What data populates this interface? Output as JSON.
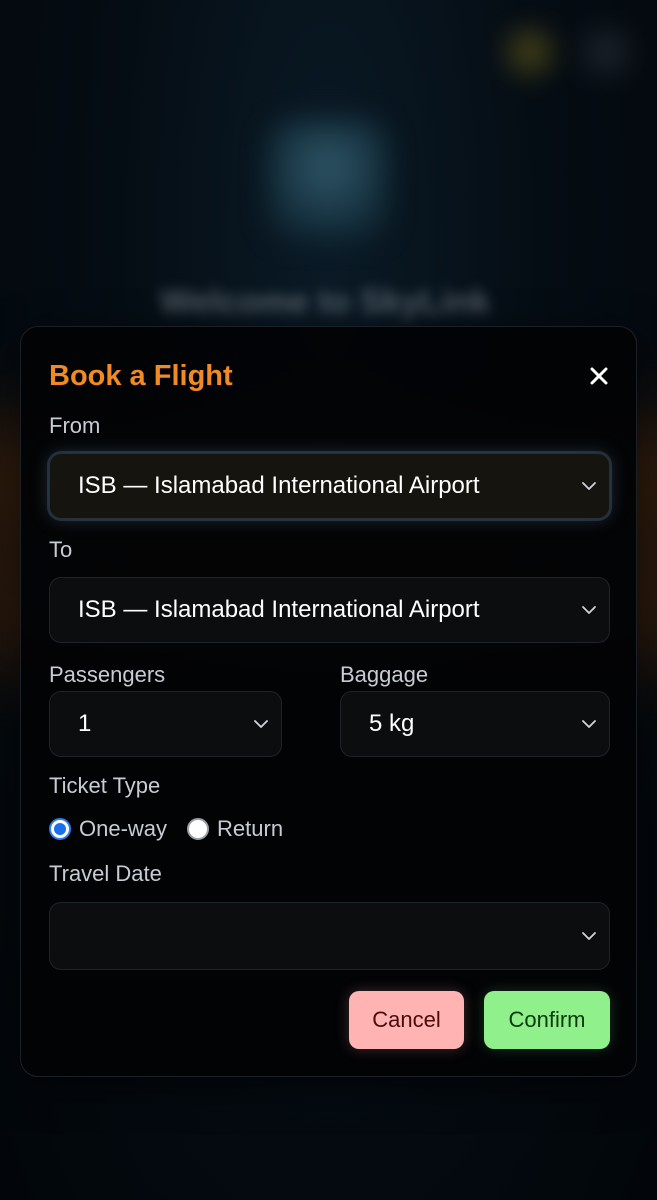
{
  "background": {
    "welcome_text": "Welcome to SkyLink"
  },
  "modal": {
    "title": "Book a Flight",
    "close_icon": "close-icon",
    "from": {
      "label": "From",
      "value": "ISB — Islamabad International Airport"
    },
    "to": {
      "label": "To",
      "value": "ISB — Islamabad International Airport"
    },
    "passengers": {
      "label": "Passengers",
      "value": "1"
    },
    "baggage": {
      "label": "Baggage",
      "value": "5 kg"
    },
    "ticket_type": {
      "label": "Ticket Type",
      "options": [
        "One-way",
        "Return"
      ],
      "selected": "One-way"
    },
    "travel_date": {
      "label": "Travel Date",
      "value": ""
    },
    "buttons": {
      "cancel": "Cancel",
      "confirm": "Confirm"
    }
  },
  "colors": {
    "title_accent": "#f08a24",
    "cancel_bg": "#ffb3b3",
    "confirm_bg": "#8ff08c",
    "radio_selected": "#1a6ff0"
  }
}
